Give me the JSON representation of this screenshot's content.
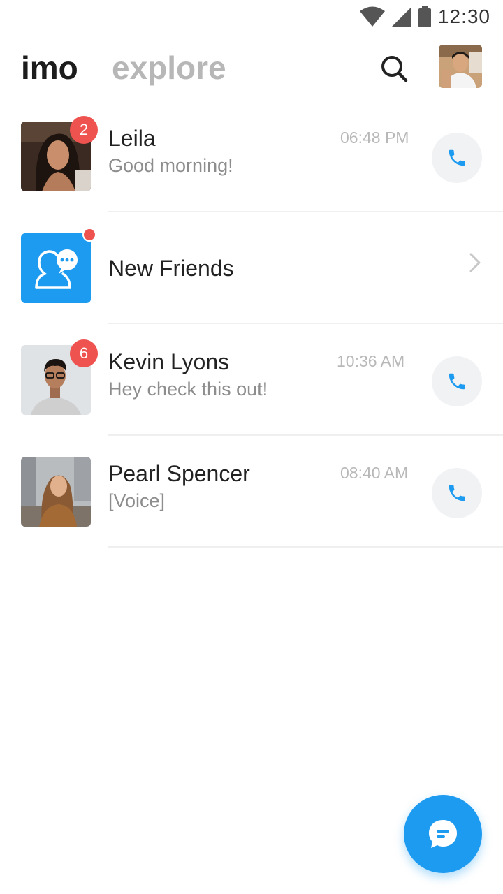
{
  "status_bar": {
    "time": "12:30"
  },
  "header": {
    "tabs": [
      {
        "label": "imo",
        "active": true
      },
      {
        "label": "explore",
        "active": false
      }
    ]
  },
  "chats": [
    {
      "name": "Leila",
      "preview": "Good morning!",
      "time": "06:48 PM",
      "badge": "2"
    },
    {
      "name": "New Friends"
    },
    {
      "name": "Kevin Lyons",
      "preview": "Hey check this out!",
      "time": "10:36 AM",
      "badge": "6"
    },
    {
      "name": "Pearl Spencer",
      "preview": "[Voice]",
      "time": "08:40 AM"
    }
  ],
  "icons": {
    "search": "search-icon",
    "call": "phone-icon",
    "fab": "chat-bubble-icon",
    "chevron": "chevron-right-icon"
  },
  "colors": {
    "accent": "#1d9bf0",
    "badge": "#ef5350",
    "title": "#1c1c1c",
    "inactive_tab": "#b7b7b7",
    "secondary_text": "#8d8d8d",
    "time_text": "#b8b8b8"
  }
}
